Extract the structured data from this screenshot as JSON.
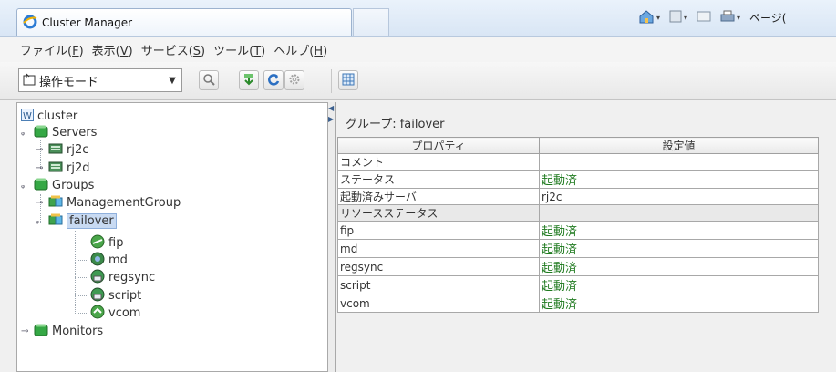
{
  "browser": {
    "tab_title": "Cluster Manager",
    "page_menu": "ページ("
  },
  "menubar": {
    "items": [
      {
        "label": "ファイル(",
        "key": "F",
        "tail": ")"
      },
      {
        "label": "表示(",
        "key": "V",
        "tail": ")"
      },
      {
        "label": "サービス(",
        "key": "S",
        "tail": ")"
      },
      {
        "label": "ツール(",
        "key": "T",
        "tail": ")"
      },
      {
        "label": "ヘルプ(",
        "key": "H",
        "tail": ")"
      }
    ]
  },
  "toolbar": {
    "mode_value": "操作モード",
    "buttons": [
      "search-icon",
      "download-icon",
      "refresh-icon",
      "gear-icon",
      "grid-icon"
    ]
  },
  "tree": {
    "root": "cluster",
    "servers_label": "Servers",
    "servers": [
      "rj2c",
      "rj2d"
    ],
    "groups_label": "Groups",
    "groups": [
      "ManagementGroup",
      "failover"
    ],
    "selected": "failover",
    "resources": [
      "fip",
      "md",
      "regsync",
      "script",
      "vcom"
    ],
    "monitors_label": "Monitors"
  },
  "detail": {
    "group_title": "グループ: failover",
    "columns": [
      "プロパティ",
      "設定値"
    ],
    "rows": [
      {
        "prop": "コメント",
        "value": "",
        "type": "plain"
      },
      {
        "prop": "ステータス",
        "value": "起動済",
        "type": "status"
      },
      {
        "prop": "起動済みサーバ",
        "value": "rj2c",
        "type": "plain"
      },
      {
        "prop": "リソースステータス",
        "value": "",
        "type": "section"
      },
      {
        "prop": "fip",
        "value": "起動済",
        "type": "status"
      },
      {
        "prop": "md",
        "value": "起動済",
        "type": "status"
      },
      {
        "prop": "regsync",
        "value": "起動済",
        "type": "status"
      },
      {
        "prop": "script",
        "value": "起動済",
        "type": "status"
      },
      {
        "prop": "vcom",
        "value": "起動済",
        "type": "status"
      }
    ]
  },
  "colors": {
    "status_green": "#1f7a1f",
    "selection": "#c8daf2",
    "folder_green": "#2e9c3a"
  }
}
